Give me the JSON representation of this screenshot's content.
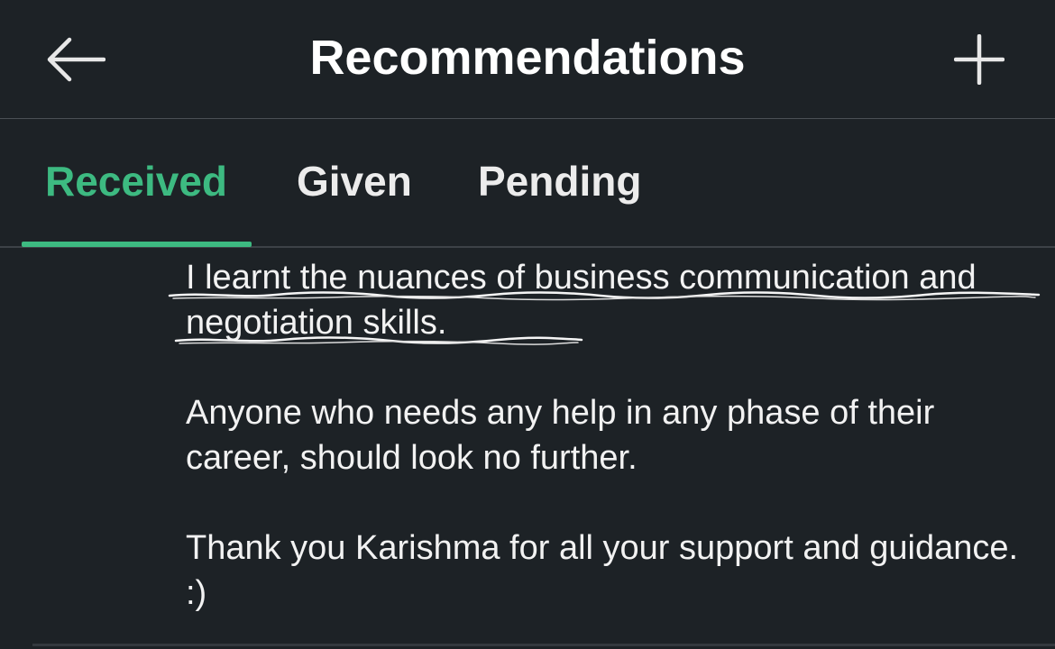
{
  "header": {
    "title": "Recommendations",
    "back_icon": "arrow-left-icon",
    "add_icon": "plus-icon"
  },
  "tabs": [
    {
      "label": "Received",
      "active": true
    },
    {
      "label": "Given",
      "active": false
    },
    {
      "label": "Pending",
      "active": false
    }
  ],
  "recommendation": {
    "paragraphs": [
      "I learnt the nuances of business communication and negotiation skills.",
      "Anyone who needs any help in any phase of their career, should look no further.",
      "Thank you Karishma for all your support and guidance.  :)"
    ],
    "highlighted_paragraph_index": 0
  },
  "colors": {
    "background": "#1d2226",
    "accent": "#3dba81",
    "text": "#f2f2f2",
    "divider": "#4a4f54"
  }
}
